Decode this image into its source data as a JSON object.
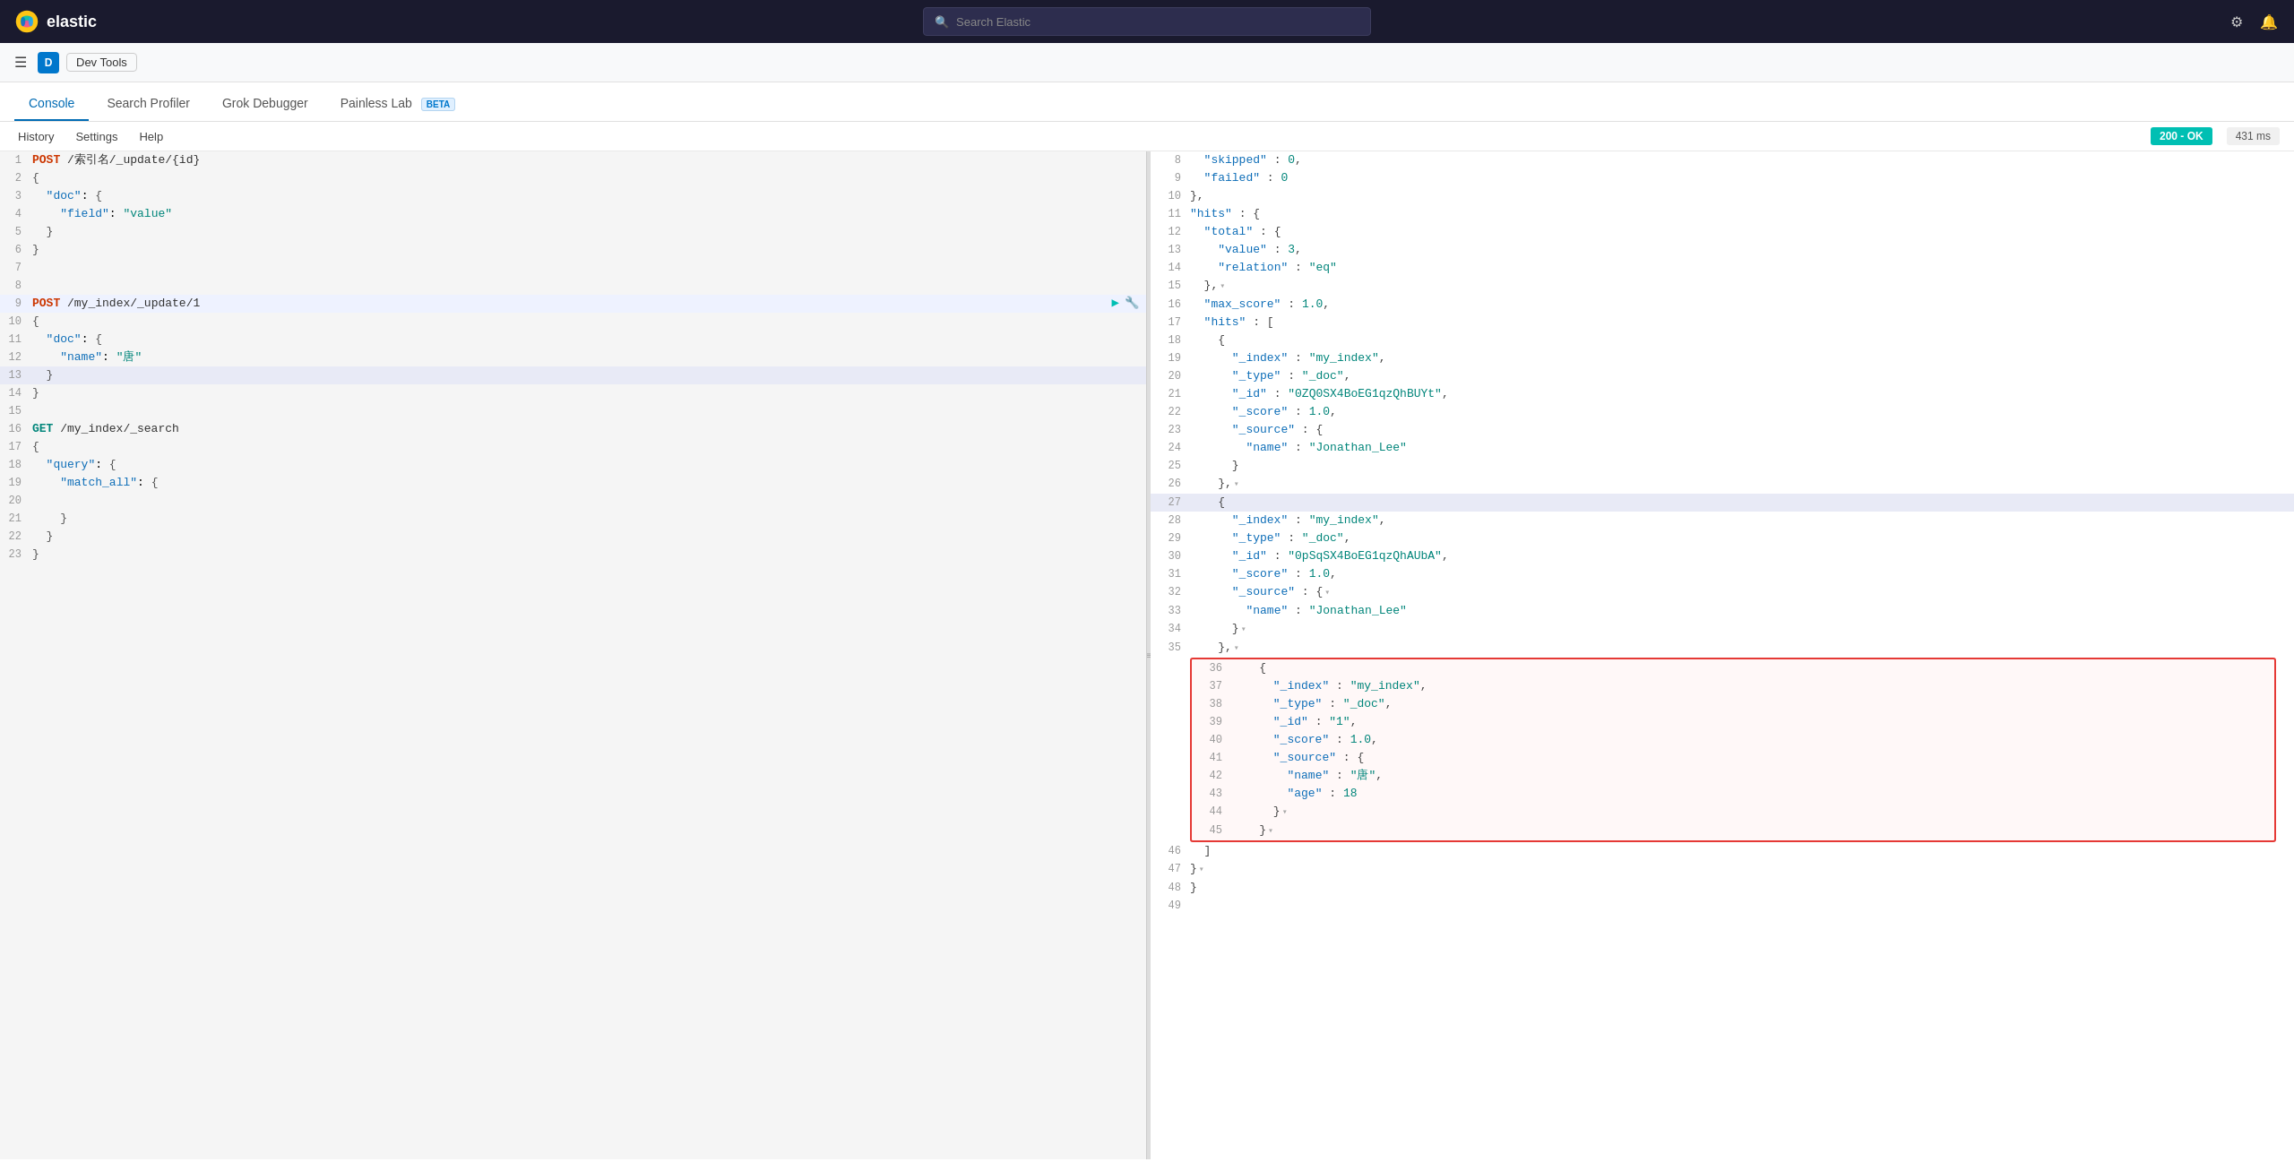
{
  "topnav": {
    "logo_text": "elastic",
    "search_placeholder": "Search Elastic",
    "search_icon": "🔍"
  },
  "breadcrumb": {
    "menu_icon": "☰",
    "avatar_label": "D",
    "app_label": "Dev Tools"
  },
  "tabs": [
    {
      "id": "console",
      "label": "Console",
      "active": true
    },
    {
      "id": "search-profiler",
      "label": "Search Profiler",
      "active": false
    },
    {
      "id": "grok-debugger",
      "label": "Grok Debugger",
      "active": false
    },
    {
      "id": "painless-lab",
      "label": "Painless Lab",
      "active": false,
      "beta": true
    }
  ],
  "toolbar": {
    "history_label": "History",
    "settings_label": "Settings",
    "help_label": "Help",
    "status": "200 - OK",
    "time": "431 ms"
  },
  "left_editor": {
    "lines": [
      {
        "num": 1,
        "indent": 0,
        "content": "POST /索引名/_update/{id}",
        "type": "method_path",
        "method": "POST",
        "path": " /索引名/_update/{id}"
      },
      {
        "num": 2,
        "indent": 0,
        "content": "{",
        "type": "brace"
      },
      {
        "num": 3,
        "indent": 1,
        "content": "  \"doc\": {",
        "type": "key_brace",
        "key": "doc"
      },
      {
        "num": 4,
        "indent": 2,
        "content": "    \"field\": \"value\"",
        "type": "kv",
        "key": "field",
        "value": "value"
      },
      {
        "num": 5,
        "indent": 1,
        "content": "  }",
        "type": "brace"
      },
      {
        "num": 6,
        "indent": 0,
        "content": "}",
        "type": "brace"
      },
      {
        "num": 7,
        "indent": 0,
        "content": "",
        "type": "empty"
      },
      {
        "num": 8,
        "indent": 0,
        "content": "",
        "type": "empty"
      },
      {
        "num": 9,
        "indent": 0,
        "content": "POST /my_index/_update/1",
        "type": "method_path",
        "method": "POST",
        "path": " /my_index/_update/1",
        "has_actions": true
      },
      {
        "num": 10,
        "indent": 0,
        "content": "{",
        "type": "brace"
      },
      {
        "num": 11,
        "indent": 1,
        "content": "  \"doc\": {",
        "type": "key_brace",
        "key": "doc"
      },
      {
        "num": 12,
        "indent": 2,
        "content": "    \"name\": \"唐\"",
        "type": "kv",
        "key": "name",
        "value": "唐"
      },
      {
        "num": 13,
        "indent": 1,
        "content": "  }",
        "type": "brace",
        "highlighted": true
      },
      {
        "num": 14,
        "indent": 0,
        "content": "}",
        "type": "brace"
      },
      {
        "num": 15,
        "indent": 0,
        "content": "",
        "type": "empty"
      },
      {
        "num": 16,
        "indent": 0,
        "content": "GET /my_index/_search",
        "type": "method_path",
        "method": "GET",
        "path": " /my_index/_search"
      },
      {
        "num": 17,
        "indent": 0,
        "content": "{",
        "type": "brace"
      },
      {
        "num": 18,
        "indent": 1,
        "content": "  \"query\": {",
        "type": "key_brace",
        "key": "query"
      },
      {
        "num": 19,
        "indent": 2,
        "content": "    \"match_all\": {",
        "type": "key_brace",
        "key": "match_all"
      },
      {
        "num": 20,
        "indent": 3,
        "content": "",
        "type": "empty"
      },
      {
        "num": 21,
        "indent": 2,
        "content": "    }",
        "type": "brace"
      },
      {
        "num": 22,
        "indent": 1,
        "content": "  }",
        "type": "brace"
      },
      {
        "num": 23,
        "indent": 0,
        "content": "}",
        "type": "brace"
      }
    ]
  },
  "right_panel": {
    "lines": [
      {
        "num": 8,
        "content": "  \"skipped\" : 0,",
        "fold": false
      },
      {
        "num": 9,
        "content": "  \"failed\" : 0",
        "fold": false
      },
      {
        "num": 10,
        "content": "},",
        "fold": false
      },
      {
        "num": 11,
        "content": "\"hits\" : {",
        "fold": false
      },
      {
        "num": 12,
        "content": "  \"total\" : {",
        "fold": false
      },
      {
        "num": 13,
        "content": "    \"value\" : 3,",
        "fold": false
      },
      {
        "num": 14,
        "content": "    \"relation\" : \"eq\"",
        "fold": false
      },
      {
        "num": 15,
        "content": "  },",
        "fold": true
      },
      {
        "num": 16,
        "content": "  \"max_score\" : 1.0,",
        "fold": false
      },
      {
        "num": 17,
        "content": "  \"hits\" : [",
        "fold": false
      },
      {
        "num": 18,
        "content": "    {",
        "fold": false
      },
      {
        "num": 19,
        "content": "      \"_index\" : \"my_index\",",
        "fold": false
      },
      {
        "num": 20,
        "content": "      \"_type\" : \"_doc\",",
        "fold": false
      },
      {
        "num": 21,
        "content": "      \"_id\" : \"0ZQ0SX4BoEG1qzQhBUYt\",",
        "fold": false
      },
      {
        "num": 22,
        "content": "      \"_score\" : 1.0,",
        "fold": false
      },
      {
        "num": 23,
        "content": "      \"_source\" : {",
        "fold": false
      },
      {
        "num": 24,
        "content": "        \"name\" : \"Jonathan_Lee\"",
        "fold": false
      },
      {
        "num": 25,
        "content": "      }",
        "fold": false
      },
      {
        "num": 26,
        "content": "    },",
        "fold": true
      },
      {
        "num": 27,
        "content": "    {",
        "fold": false,
        "highlighted": true
      },
      {
        "num": 28,
        "content": "      \"_index\" : \"my_index\",",
        "fold": false
      },
      {
        "num": 29,
        "content": "      \"_type\" : \"_doc\",",
        "fold": false
      },
      {
        "num": 30,
        "content": "      \"_id\" : \"0pSqSX4BoEG1qzQhAUbA\",",
        "fold": false
      },
      {
        "num": 31,
        "content": "      \"_score\" : 1.0,",
        "fold": false
      },
      {
        "num": 32,
        "content": "      \"_source\" : {",
        "fold": true
      },
      {
        "num": 33,
        "content": "        \"name\" : \"Jonathan_Lee\"",
        "fold": false
      },
      {
        "num": 34,
        "content": "      }",
        "fold": true
      },
      {
        "num": 35,
        "content": "    },",
        "fold": true
      },
      {
        "num": 36,
        "content": "    {",
        "fold": false,
        "red_box_start": true
      },
      {
        "num": 37,
        "content": "      \"_index\" : \"my_index\",",
        "fold": false
      },
      {
        "num": 38,
        "content": "      \"_type\" : \"_doc\",",
        "fold": false
      },
      {
        "num": 39,
        "content": "      \"_id\" : \"1\",",
        "fold": false
      },
      {
        "num": 40,
        "content": "      \"_score\" : 1.0,",
        "fold": false
      },
      {
        "num": 41,
        "content": "      \"_source\" : {",
        "fold": false
      },
      {
        "num": 42,
        "content": "        \"name\" : \"唐\",",
        "fold": false
      },
      {
        "num": 43,
        "content": "        \"age\" : 18",
        "fold": false
      },
      {
        "num": 44,
        "content": "      }",
        "fold": true
      },
      {
        "num": 45,
        "content": "    }",
        "fold": true,
        "red_box_end": true
      },
      {
        "num": 46,
        "content": "  ]",
        "fold": false
      },
      {
        "num": 47,
        "content": "}",
        "fold": true
      },
      {
        "num": 48,
        "content": "}",
        "fold": false
      },
      {
        "num": 49,
        "content": "",
        "fold": false
      }
    ]
  }
}
